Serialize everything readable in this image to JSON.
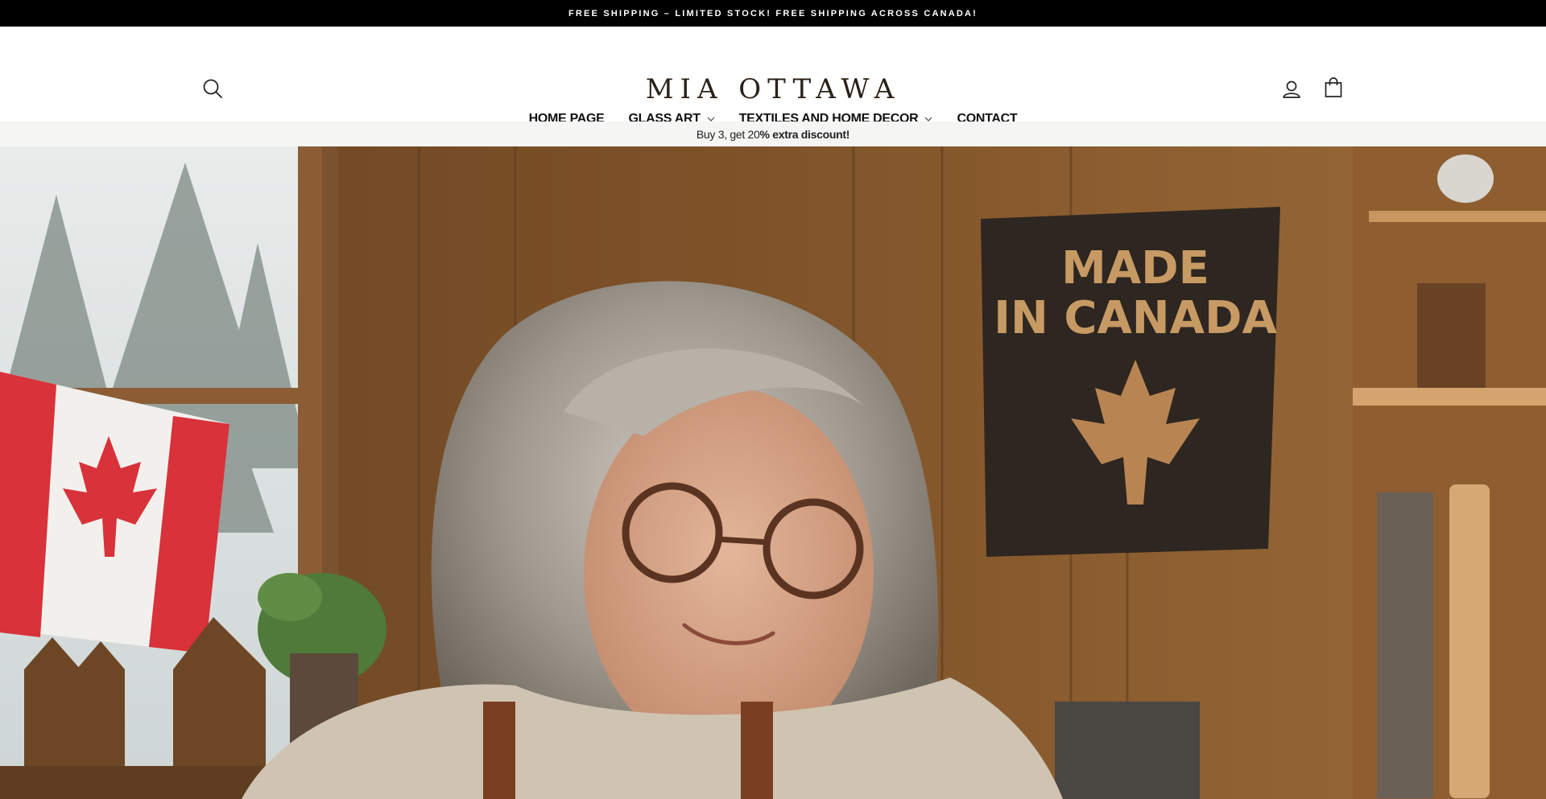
{
  "announcement": {
    "text": "FREE SHIPPING – LIMITED STOCK! FREE SHIPPING ACROSS CANADA!"
  },
  "header": {
    "logo": "MIA OTTAWA",
    "icons": {
      "search": "search-icon",
      "account": "user-icon",
      "cart": "shopping-bag-icon"
    }
  },
  "nav": {
    "items": [
      {
        "label": "HOME PAGE",
        "has_dropdown": false
      },
      {
        "label": "GLASS ART",
        "has_dropdown": true
      },
      {
        "label": "TEXTILES AND HOME DECOR",
        "has_dropdown": true
      },
      {
        "label": "CONTACT",
        "has_dropdown": false
      }
    ]
  },
  "promo": {
    "text_regular": "Buy 3, get 20",
    "text_bold": "% extra discount!"
  },
  "hero": {
    "sign_line1": "MADE",
    "sign_line2": "IN CANADA"
  },
  "colors": {
    "announcement_bg": "#000000",
    "promo_bg": "#f5f5f4",
    "logo": "#2a2118"
  }
}
